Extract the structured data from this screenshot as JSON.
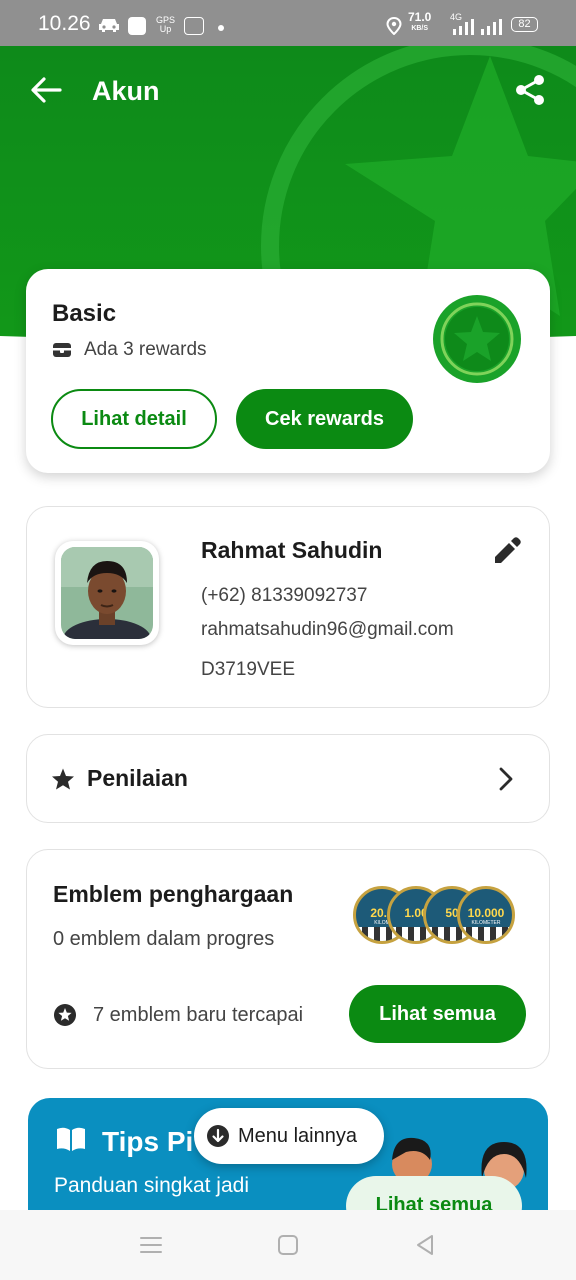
{
  "status_bar": {
    "time": "10.26",
    "gps_label": "GPS",
    "gps_sub": "Up",
    "speed_value": "71.0",
    "speed_unit": "KB/S",
    "network": "4G",
    "battery": "82"
  },
  "header": {
    "title": "Akun",
    "back_icon": "arrow-left-icon",
    "share_icon": "share-icon"
  },
  "tier": {
    "name": "Basic",
    "rewards_text": "Ada 3 rewards",
    "detail_button": "Lihat detail",
    "rewards_button": "Cek rewards"
  },
  "profile": {
    "name": "Rahmat Sahudin",
    "phone": "(+62) 81339092737",
    "email": "rahmatsahudin96@gmail.com",
    "plate": "D3719VEE"
  },
  "rating": {
    "label": "Penilaian"
  },
  "emblem": {
    "title": "Emblem penghargaan",
    "progress_text": "0 emblem dalam progres",
    "achieved_text": "7 emblem baru tercapai",
    "view_all_button": "Lihat semua",
    "medals": [
      {
        "value": "20.0",
        "label": "KILOM"
      },
      {
        "value": "1.00",
        "label": ""
      },
      {
        "value": "50",
        "label": ""
      },
      {
        "value": "10.000",
        "label": "KILOMETER"
      }
    ]
  },
  "tips": {
    "title": "Tips Pi",
    "subtitle": "Panduan singkat jadi",
    "button": "Lihat semua"
  },
  "menu_more": {
    "label": "Menu lainnya"
  },
  "colors": {
    "brand_green": "#0b8a12",
    "header_green": "#139b21",
    "tips_blue": "#0a8fc0"
  }
}
